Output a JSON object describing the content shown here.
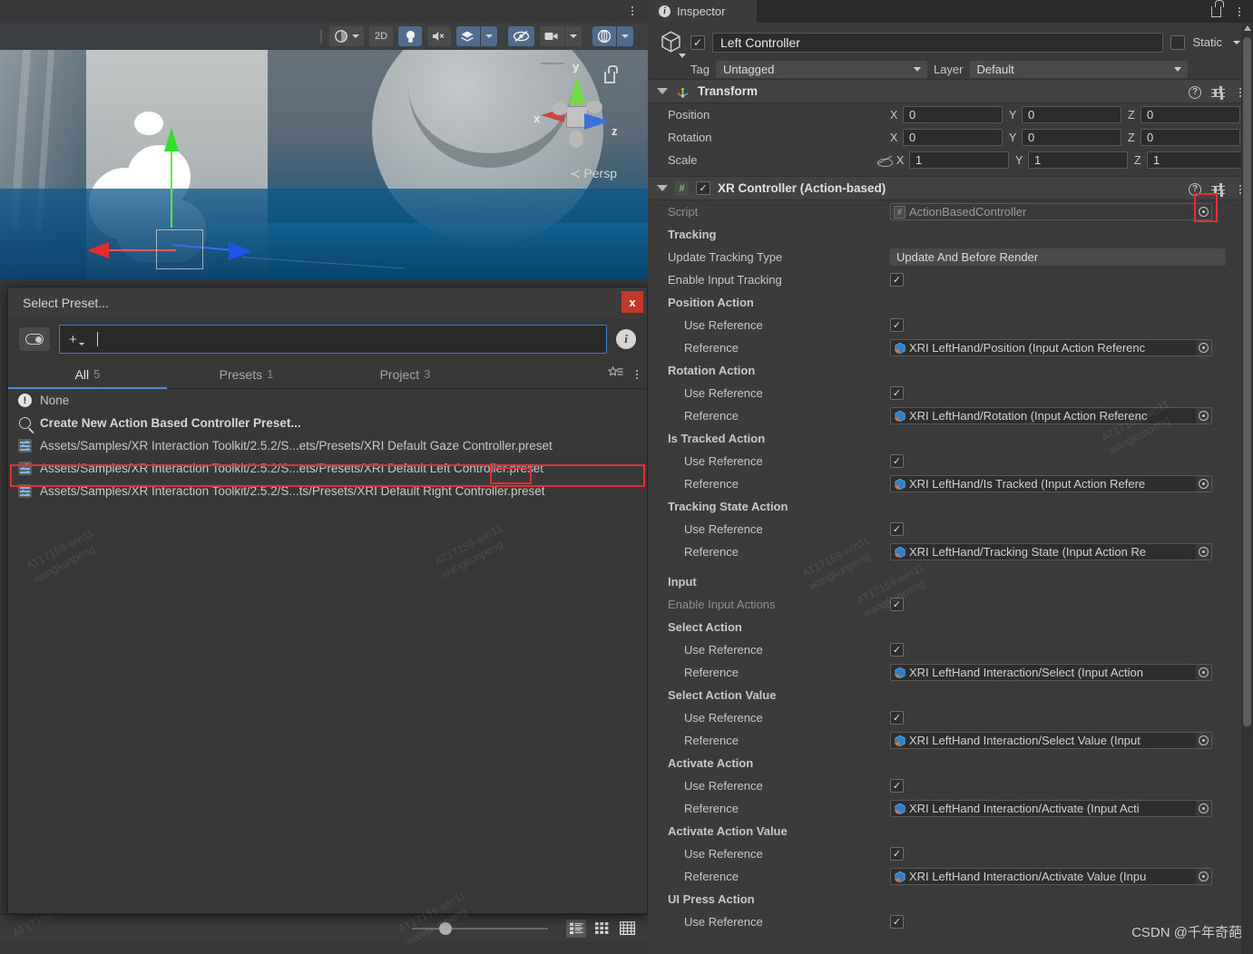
{
  "scene": {
    "toolbar": {
      "shading_label": "shading-mode",
      "twod_label": "2D",
      "lighting_icon": "light-bulb-icon",
      "audio_icon": "audio-mute-icon",
      "fx_icon": "effects-icon",
      "visibility_icon": "scene-visibility-off-icon",
      "camera_icon": "camera-icon",
      "gizmos_icon": "gizmos-icon"
    },
    "gizmo": {
      "x_label": "x",
      "y_label": "y",
      "z_label": "z",
      "persp_label": "≺ Persp"
    }
  },
  "preset_dialog": {
    "title": "Select Preset...",
    "close_label": "x",
    "search_value": "",
    "search_placeholder": "",
    "tabs": [
      {
        "label": "All",
        "count": "5",
        "active": true
      },
      {
        "label": "Presets",
        "count": "1",
        "active": false
      },
      {
        "label": "Project",
        "count": "3",
        "active": false
      }
    ],
    "items": [
      {
        "label": "None",
        "icon": "warning-icon",
        "bold": false
      },
      {
        "label": "Create New Action Based Controller Preset...",
        "icon": "search-icon",
        "bold": true
      },
      {
        "label": "Assets/Samples/XR Interaction Toolkit/2.5.2/S...ets/Presets/XRI Default Gaze Controller.preset",
        "icon": "preset-icon",
        "bold": false
      },
      {
        "label": "Assets/Samples/XR Interaction Toolkit/2.5.2/S...ets/Presets/XRI Default Left Controller.preset",
        "icon": "preset-icon",
        "bold": false,
        "highlighted": true
      },
      {
        "label": "Assets/Samples/XR Interaction Toolkit/2.5.2/S...ts/Presets/XRI Default Right Controller.preset",
        "icon": "preset-icon",
        "bold": false
      }
    ]
  },
  "inspector": {
    "tab_label": "Inspector",
    "gameobject": {
      "name": "Left Controller",
      "enabled": true,
      "static_label": "Static",
      "tag_label": "Tag",
      "tag_value": "Untagged",
      "layer_label": "Layer",
      "layer_value": "Default"
    },
    "transform": {
      "title": "Transform",
      "rows": [
        {
          "label": "Position",
          "x": "0",
          "y": "0",
          "z": "0"
        },
        {
          "label": "Rotation",
          "x": "0",
          "y": "0",
          "z": "0"
        },
        {
          "label": "Scale",
          "x": "1",
          "y": "1",
          "z": "1"
        }
      ],
      "axis_labels": {
        "x": "X",
        "y": "Y",
        "z": "Z"
      }
    },
    "xr_controller": {
      "title": "XR Controller (Action-based)",
      "enabled": true,
      "script_label": "Script",
      "script_value": "ActionBasedController",
      "sections": [
        {
          "kind": "header",
          "label": "Tracking"
        },
        {
          "kind": "dropdown",
          "label": "Update Tracking Type",
          "value": "Update And Before Render"
        },
        {
          "kind": "checkbox",
          "label": "Enable Input Tracking",
          "checked": true
        },
        {
          "kind": "header",
          "label": "Position Action"
        },
        {
          "kind": "checkbox",
          "label": "Use Reference",
          "checked": true,
          "indent": true
        },
        {
          "kind": "object",
          "label": "Reference",
          "value": "XRI LeftHand/Position (Input Action Referenc",
          "indent": true
        },
        {
          "kind": "header",
          "label": "Rotation Action"
        },
        {
          "kind": "checkbox",
          "label": "Use Reference",
          "checked": true,
          "indent": true
        },
        {
          "kind": "object",
          "label": "Reference",
          "value": "XRI LeftHand/Rotation (Input Action Referenc",
          "indent": true
        },
        {
          "kind": "header",
          "label": "Is Tracked Action"
        },
        {
          "kind": "checkbox",
          "label": "Use Reference",
          "checked": true,
          "indent": true
        },
        {
          "kind": "object",
          "label": "Reference",
          "value": "XRI LeftHand/Is Tracked (Input Action Refere",
          "indent": true
        },
        {
          "kind": "header",
          "label": "Tracking State Action"
        },
        {
          "kind": "checkbox",
          "label": "Use Reference",
          "checked": true,
          "indent": true
        },
        {
          "kind": "object",
          "label": "Reference",
          "value": "XRI LeftHand/Tracking State (Input Action Re",
          "indent": true
        },
        {
          "kind": "spacer"
        },
        {
          "kind": "header",
          "label": "Input"
        },
        {
          "kind": "checkbox",
          "label": "Enable Input Actions",
          "checked": true,
          "dim": true
        },
        {
          "kind": "header",
          "label": "Select Action"
        },
        {
          "kind": "checkbox",
          "label": "Use Reference",
          "checked": true,
          "indent": true
        },
        {
          "kind": "object",
          "label": "Reference",
          "value": "XRI LeftHand Interaction/Select (Input Action",
          "indent": true
        },
        {
          "kind": "header",
          "label": "Select Action Value"
        },
        {
          "kind": "checkbox",
          "label": "Use Reference",
          "checked": true,
          "indent": true
        },
        {
          "kind": "object",
          "label": "Reference",
          "value": "XRI LeftHand Interaction/Select Value (Input",
          "indent": true
        },
        {
          "kind": "header",
          "label": "Activate Action"
        },
        {
          "kind": "checkbox",
          "label": "Use Reference",
          "checked": true,
          "indent": true
        },
        {
          "kind": "object",
          "label": "Reference",
          "value": "XRI LeftHand Interaction/Activate (Input Acti",
          "indent": true
        },
        {
          "kind": "header",
          "label": "Activate Action Value"
        },
        {
          "kind": "checkbox",
          "label": "Use Reference",
          "checked": true,
          "indent": true
        },
        {
          "kind": "object",
          "label": "Reference",
          "value": "XRI LeftHand Interaction/Activate Value (Inpu",
          "indent": true
        },
        {
          "kind": "header",
          "label": "UI Press Action"
        },
        {
          "kind": "checkbox",
          "label": "Use Reference",
          "checked": true,
          "indent": true
        }
      ]
    }
  },
  "watermarks": {
    "csdn": "CSDN @千年奇葩",
    "text1": "AT17159-win11",
    "text2": "wangkunpeng"
  },
  "colors": {
    "accent_blue": "#4a8bd4",
    "highlight_red": "#e03131",
    "panel_bg": "#383838",
    "toolbar_active": "#4f6b8e"
  }
}
